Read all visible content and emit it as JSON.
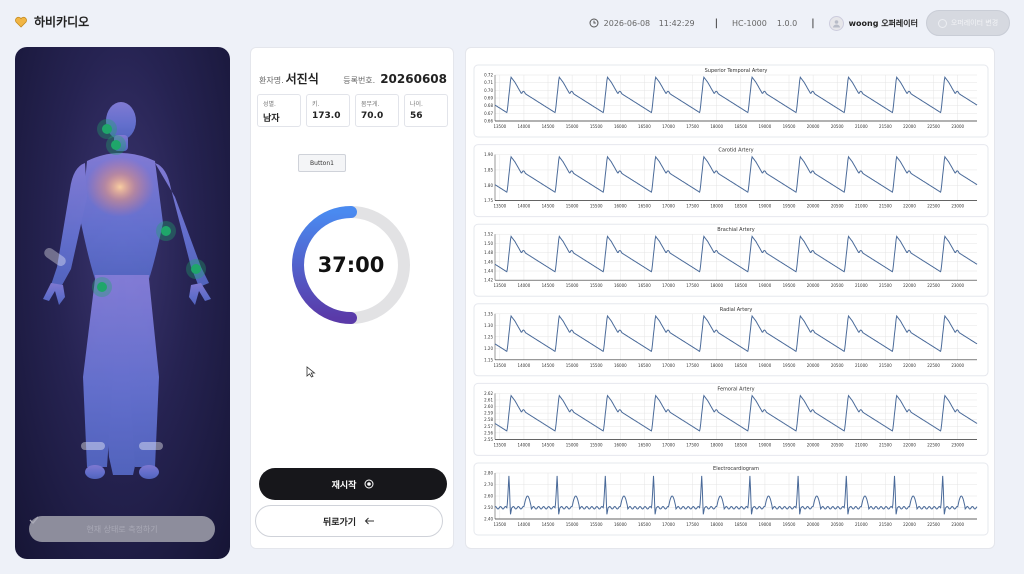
{
  "header": {
    "app_name": "하비카디오",
    "date": "2026-06-08",
    "time": "11:42:29",
    "device_model": "HC-1000",
    "device_version": "1.0.0",
    "user_name": "woong 오퍼레이터",
    "operator_change_label": "오퍼레이터 변경"
  },
  "body_panel": {
    "status_button_label": "현재 상태로 측정하기"
  },
  "patient": {
    "name_label": "환자명.",
    "name": "서진식",
    "reg_label": "등록번호.",
    "reg_no": "20260608",
    "stats": [
      {
        "label": "성별.",
        "value": "남자"
      },
      {
        "label": "키.",
        "value": "173.0"
      },
      {
        "label": "몸무게.",
        "value": "70.0"
      },
      {
        "label": "나이.",
        "value": "56"
      }
    ],
    "button1_label": "Button1",
    "timer": "37:00",
    "timer_progress": 0.5,
    "restart_label": "재시작",
    "back_label": "뒤로가기"
  },
  "colors": {
    "accent_blue": "#4a8af0",
    "accent_purple": "#5a3aa8",
    "waveform": "#4a6a99",
    "sensor_green": "#1fa66a"
  },
  "chart_data": [
    {
      "type": "line",
      "title": "Superior Temporal Artery",
      "x_ticks": [
        13500,
        14000,
        14500,
        15000,
        15500,
        16000,
        16500,
        17000,
        17500,
        18000,
        18500,
        19000,
        19500,
        20000,
        20500,
        21000,
        21500,
        22000,
        22500,
        23000
      ],
      "y_ticks": [
        "0.72",
        "0.71",
        "0.70",
        "0.69",
        "0.68",
        "0.67",
        "0.66"
      ],
      "xlim": [
        13400,
        23400
      ],
      "ylim": [
        0.66,
        0.72
      ],
      "grid": true,
      "beats": 10
    },
    {
      "type": "line",
      "title": "Carotid Artery",
      "x_ticks": [
        13500,
        14000,
        14500,
        15000,
        15500,
        16000,
        16500,
        17000,
        17500,
        18000,
        18500,
        19000,
        19500,
        20000,
        20500,
        21000,
        21500,
        22000,
        22500,
        23000
      ],
      "y_ticks": [
        "1.90",
        "1.85",
        "1.80",
        "1.75"
      ],
      "xlim": [
        13400,
        23400
      ],
      "ylim": [
        1.75,
        1.9
      ],
      "grid": true,
      "beats": 10
    },
    {
      "type": "line",
      "title": "Brachial Artery",
      "x_ticks": [
        13500,
        14000,
        14500,
        15000,
        15500,
        16000,
        16500,
        17000,
        17500,
        18000,
        18500,
        19000,
        19500,
        20000,
        20500,
        21000,
        21500,
        22000,
        22500,
        23000
      ],
      "y_ticks": [
        "1.52",
        "1.50",
        "1.48",
        "1.46",
        "1.44",
        "1.42"
      ],
      "xlim": [
        13400,
        23400
      ],
      "ylim": [
        1.42,
        1.52
      ],
      "grid": true,
      "beats": 10
    },
    {
      "type": "line",
      "title": "Radial Artery",
      "x_ticks": [
        13500,
        14000,
        14500,
        15000,
        15500,
        16000,
        16500,
        17000,
        17500,
        18000,
        18500,
        19000,
        19500,
        20000,
        20500,
        21000,
        21500,
        22000,
        22500,
        23000
      ],
      "y_ticks": [
        "1.35",
        "1.30",
        "1.25",
        "1.20",
        "1.15"
      ],
      "xlim": [
        13400,
        23400
      ],
      "ylim": [
        1.15,
        1.35
      ],
      "grid": true,
      "beats": 10
    },
    {
      "type": "line",
      "title": "Femoral Artery",
      "x_ticks": [
        13500,
        14000,
        14500,
        15000,
        15500,
        16000,
        16500,
        17000,
        17500,
        18000,
        18500,
        19000,
        19500,
        20000,
        20500,
        21000,
        21500,
        22000,
        22500,
        23000
      ],
      "y_ticks": [
        "2.62",
        "2.61",
        "2.60",
        "2.59",
        "2.58",
        "2.57",
        "2.56",
        "2.55"
      ],
      "xlim": [
        13400,
        23400
      ],
      "ylim": [
        2.55,
        2.62
      ],
      "grid": true,
      "beats": 10
    },
    {
      "type": "line",
      "title": "Electrocardiogram",
      "x_ticks": [
        13500,
        14000,
        14500,
        15000,
        15500,
        16000,
        16500,
        17000,
        17500,
        18000,
        18500,
        19000,
        19500,
        20000,
        20500,
        21000,
        21500,
        22000,
        22500,
        23000
      ],
      "y_ticks": [
        "2.80",
        "2.70",
        "2.60",
        "2.50",
        "2.40"
      ],
      "xlim": [
        13400,
        23400
      ],
      "ylim": [
        2.35,
        2.85
      ],
      "grid": true,
      "beats": 10
    }
  ]
}
